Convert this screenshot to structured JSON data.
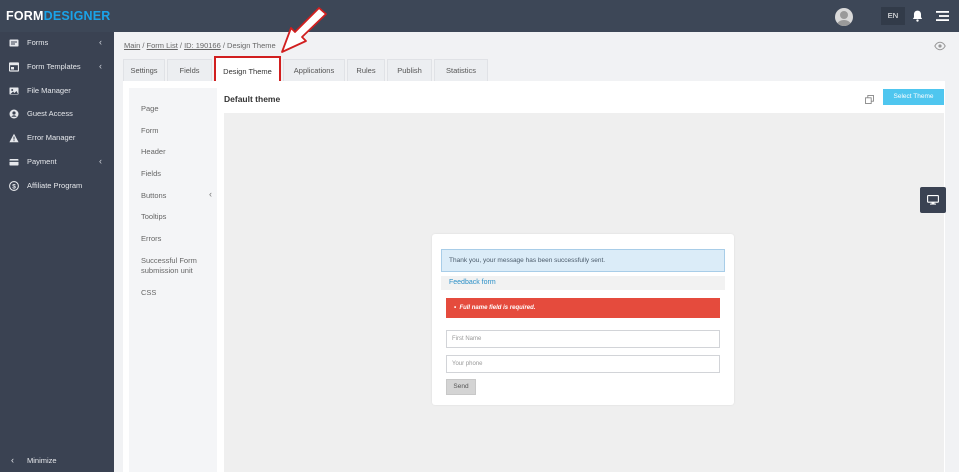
{
  "app": {
    "logo_part1": "FORM",
    "logo_part2": "DESIGNER",
    "language": "EN",
    "brand_color": "#1aa3e8",
    "topbar_color": "#3d4757"
  },
  "sidebar": {
    "items": [
      {
        "label": "Forms",
        "icon": "forms-icon",
        "has_submenu": true
      },
      {
        "label": "Form Templates",
        "icon": "form-templates-icon",
        "has_submenu": true
      },
      {
        "label": "File Manager",
        "icon": "file-manager-icon",
        "has_submenu": false
      },
      {
        "label": "Guest Access",
        "icon": "guest-access-icon",
        "has_submenu": false
      },
      {
        "label": "Error Manager",
        "icon": "warning-icon",
        "has_submenu": false
      },
      {
        "label": "Payment",
        "icon": "payment-icon",
        "has_submenu": true
      },
      {
        "label": "Affiliate Program",
        "icon": "dollar-icon",
        "has_submenu": false
      }
    ],
    "minimize_label": "Minimize"
  },
  "breadcrumb": {
    "main": "Main",
    "form_list": "Form List",
    "form_id": "ID: 190166",
    "current": "Design Theme",
    "separator": " / "
  },
  "tabs": [
    {
      "label": "Settings",
      "active": false
    },
    {
      "label": "Fields",
      "active": false
    },
    {
      "label": "Design Theme",
      "active": true
    },
    {
      "label": "Applications",
      "active": false
    },
    {
      "label": "Rules",
      "active": false
    },
    {
      "label": "Publish",
      "active": false
    },
    {
      "label": "Statistics",
      "active": false
    }
  ],
  "design_menu": {
    "items": [
      {
        "label": "Page"
      },
      {
        "label": "Form"
      },
      {
        "label": "Header"
      },
      {
        "label": "Fields"
      },
      {
        "label": "Buttons",
        "has_submenu": true
      },
      {
        "label": "Tooltips"
      },
      {
        "label": "Errors"
      },
      {
        "label": "Successful Form submission unit"
      },
      {
        "label": "CSS"
      }
    ]
  },
  "theme": {
    "title": "Default theme",
    "select_button": "Select Theme",
    "select_button_color": "#4fc6ef"
  },
  "preview_form": {
    "success_message": "Thank you, your message has been successfully sent.",
    "form_title": "Feedback form",
    "error_message": "Full name field is required.",
    "error_color": "#e54b3d",
    "fields": [
      {
        "placeholder": "First Name"
      },
      {
        "placeholder": "Your phone"
      }
    ],
    "submit_label": "Send"
  }
}
